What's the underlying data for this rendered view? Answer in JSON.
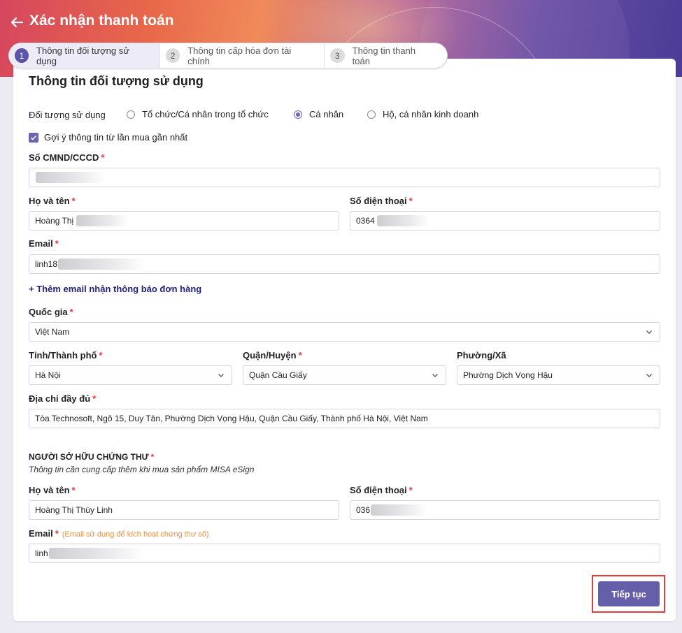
{
  "header": {
    "title": "Xác nhận thanh toán"
  },
  "steps": [
    {
      "num": "1",
      "label": "Thông tin đối tượng sử dụng"
    },
    {
      "num": "2",
      "label": "Thông tin cấp hóa đơn tài chính"
    },
    {
      "num": "3",
      "label": "Thông tin thanh toán"
    }
  ],
  "section": {
    "title": "Thông tin đối tượng sử dụng"
  },
  "user_type": {
    "label": "Đối tượng sử dụng",
    "options": [
      "Tổ chức/Cá nhân trong tổ chức",
      "Cá nhân",
      "Hộ, cá nhân kinh doanh"
    ],
    "selected": "Cá nhân"
  },
  "suggest": {
    "label": "Gợi ý thông tin từ lần mua gần nhất",
    "checked": true
  },
  "id_number": {
    "label": "Số CMND/CCCD",
    "required": "*",
    "value": ""
  },
  "full_name": {
    "label": "Họ và tên",
    "required": "*",
    "value": "Hoàng Thị"
  },
  "phone": {
    "label": "Số điện thoại",
    "required": "*",
    "value": "0364"
  },
  "email": {
    "label": "Email",
    "required": "*",
    "value": "linh18"
  },
  "add_email_link": "+ Thêm email nhận thông báo đơn hàng",
  "country": {
    "label": "Quốc gia",
    "required": "*",
    "value": "Việt Nam"
  },
  "province": {
    "label": "Tỉnh/Thành phố",
    "required": "*",
    "value": "Hà Nội"
  },
  "district": {
    "label": "Quận/Huyện",
    "required": "*",
    "value": "Quận Cầu Giấy"
  },
  "ward": {
    "label": "Phường/Xã",
    "value": "Phường Dịch Vọng Hậu"
  },
  "address": {
    "label": "Địa chỉ đầy đủ",
    "required": "*",
    "value": "Tòa Technosoft, Ngõ 15, Duy Tân, Phường Dịch Vọng Hậu, Quận Cầu Giấy, Thành phố Hà Nội, Việt Nam"
  },
  "owner": {
    "title": "NGƯỜI SỞ HỮU CHỨNG THƯ",
    "required": "*",
    "subtitle": "Thông tin cần cung cấp thêm khi mua sản phẩm MISA eSign",
    "full_name": {
      "label": "Họ và tên",
      "required": "*",
      "value": "Hoàng Thị Thùy Linh"
    },
    "phone": {
      "label": "Số điện thoại",
      "required": "*",
      "value": "036"
    },
    "email": {
      "label": "Email",
      "required": "*",
      "note": "(Email sử dụng để kích hoạt chứng thư số)",
      "value": "linh"
    }
  },
  "next_button": "Tiếp tục",
  "colors": {
    "accent": "#645fa8",
    "required": "#e53935",
    "note": "#f0903a",
    "highlight": "#e23b3b"
  }
}
